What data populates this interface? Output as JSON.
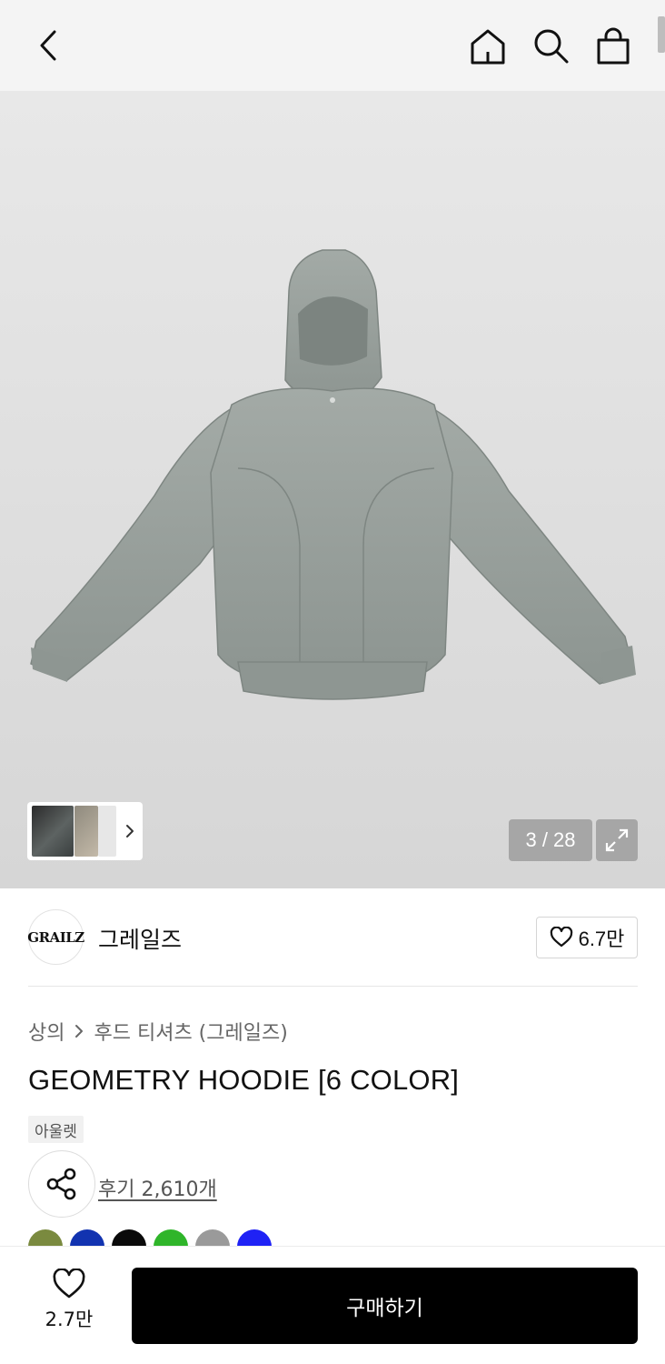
{
  "header": {
    "back_icon": "chevron-left-icon",
    "home_icon": "home-icon",
    "search_icon": "search-icon",
    "cart_icon": "shopping-bag-icon"
  },
  "gallery": {
    "current_index": 3,
    "total": 28,
    "counter_text": "3 / 28",
    "expand_icon": "expand-icon",
    "thumbnails_more_icon": "chevron-right-icon",
    "main_image": "gray hoodie product photo"
  },
  "brand": {
    "logo_text": "GRAILZ",
    "name": "그레일즈",
    "like_count": "6.7만",
    "like_icon": "heart-outline-icon"
  },
  "product": {
    "breadcrumb": [
      "상의",
      "후드 티셔츠 (그레일즈)"
    ],
    "breadcrumb_separator": "chevron-right-icon",
    "title": "GEOMETRY HOODIE [6 COLOR]",
    "tag": "아울렛",
    "review_text": "후기 2,610개",
    "share_icon": "share-icon",
    "color_swatches": [
      "#7a8a3f",
      "#1233b0",
      "#0a0a0a",
      "#2fb52a",
      "#9a9a9a",
      "#1f22f5"
    ]
  },
  "bottom_bar": {
    "wish_icon": "heart-outline-icon",
    "wish_count": "2.7만",
    "buy_label": "구매하기"
  }
}
